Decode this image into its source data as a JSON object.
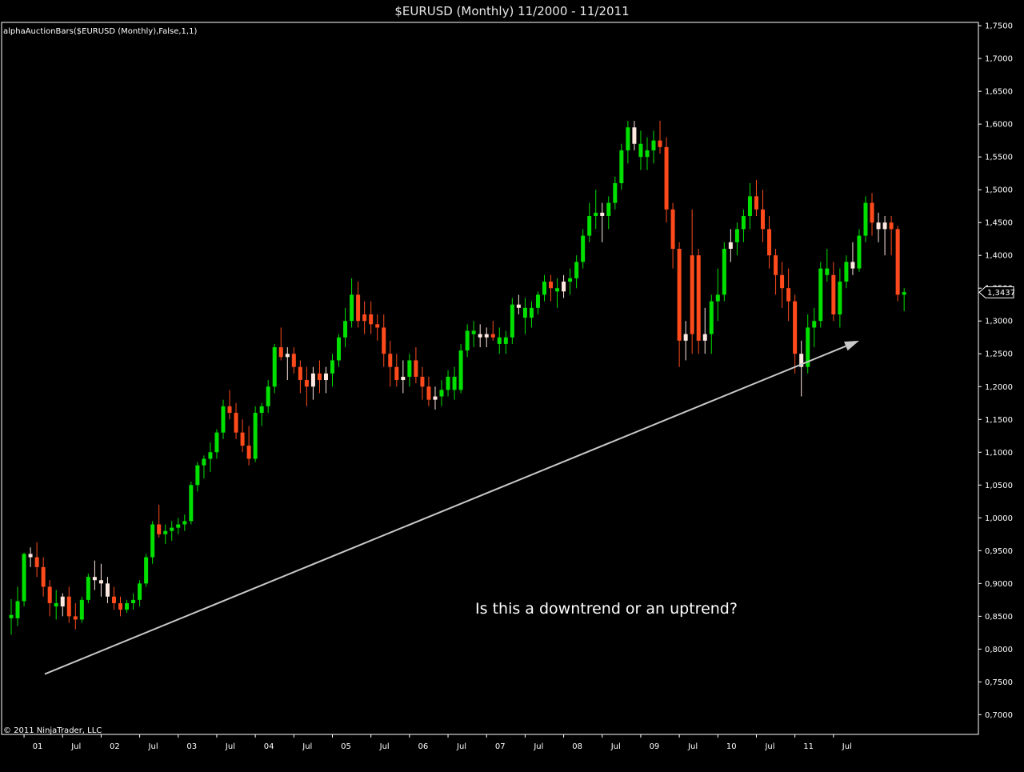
{
  "window": {
    "title": "$EURUSD (Monthly)  11/2000 - 11/2011"
  },
  "indicator_label": "alphaAuctionBars($EURUSD (Monthly),False,1,1)",
  "copyright": "© 2011 NinjaTrader, LLC",
  "annotation": {
    "text": "Is this a downtrend or an uptrend?"
  },
  "colors": {
    "background": "#000000",
    "up": "#00e000",
    "down": "#ff4a1c",
    "neutral": "#ffe8e0",
    "trend_arrow": "#c8c8c8",
    "axis": "#ffffff"
  },
  "chart_data": {
    "type": "candlestick",
    "symbol": "$EURUSD",
    "timeframe": "Monthly",
    "ylim": [
      0.67,
      1.755
    ],
    "y_ticks": [
      "1,7500",
      "1,7000",
      "1,6500",
      "1,6000",
      "1,5500",
      "1,5000",
      "1,4500",
      "1,4000",
      "1,3500",
      "1,3000",
      "1,2500",
      "1,2000",
      "1,1500",
      "1,1000",
      "1,0500",
      "1,0000",
      "0,9500",
      "0,9000",
      "0,8500",
      "0,8000",
      "0,7500",
      "0,7000"
    ],
    "x_ticks": [
      "01",
      "Jul",
      "02",
      "Jul",
      "03",
      "Jul",
      "04",
      "Jul",
      "05",
      "Jul",
      "06",
      "Jul",
      "07",
      "Jul",
      "08",
      "Jul",
      "09",
      "Jul",
      "10",
      "Jul",
      "11",
      "Jul"
    ],
    "last_price": "1,3437",
    "trend_arrow": {
      "from": [
        0,
        0.762
      ],
      "to": [
        132,
        1.27
      ]
    },
    "candles": [
      [
        0.852,
        0.876,
        0.822,
        0.847,
        "up"
      ],
      [
        0.847,
        0.895,
        0.835,
        0.873,
        "up"
      ],
      [
        0.873,
        0.947,
        0.865,
        0.945,
        "up"
      ],
      [
        0.945,
        0.955,
        0.925,
        0.94,
        "neutral"
      ],
      [
        0.94,
        0.963,
        0.91,
        0.925,
        "down"
      ],
      [
        0.925,
        0.94,
        0.88,
        0.895,
        "down"
      ],
      [
        0.895,
        0.905,
        0.85,
        0.87,
        "down"
      ],
      [
        0.87,
        0.89,
        0.845,
        0.865,
        "up"
      ],
      [
        0.865,
        0.885,
        0.85,
        0.88,
        "neutral"
      ],
      [
        0.88,
        0.895,
        0.84,
        0.85,
        "down"
      ],
      [
        0.85,
        0.87,
        0.83,
        0.845,
        "down"
      ],
      [
        0.845,
        0.88,
        0.84,
        0.875,
        "up"
      ],
      [
        0.875,
        0.915,
        0.87,
        0.91,
        "up"
      ],
      [
        0.91,
        0.935,
        0.89,
        0.905,
        "neutral"
      ],
      [
        0.905,
        0.93,
        0.88,
        0.9,
        "neutral"
      ],
      [
        0.9,
        0.91,
        0.87,
        0.88,
        "neutral"
      ],
      [
        0.88,
        0.895,
        0.86,
        0.87,
        "down"
      ],
      [
        0.87,
        0.88,
        0.85,
        0.86,
        "down"
      ],
      [
        0.86,
        0.875,
        0.855,
        0.87,
        "up"
      ],
      [
        0.87,
        0.885,
        0.86,
        0.875,
        "up"
      ],
      [
        0.875,
        0.905,
        0.865,
        0.9,
        "up"
      ],
      [
        0.9,
        0.945,
        0.895,
        0.94,
        "up"
      ],
      [
        0.94,
        0.995,
        0.93,
        0.99,
        "up"
      ],
      [
        0.99,
        1.02,
        0.97,
        0.975,
        "down"
      ],
      [
        0.975,
        0.99,
        0.96,
        0.98,
        "up"
      ],
      [
        0.98,
        0.995,
        0.965,
        0.985,
        "up"
      ],
      [
        0.985,
        1.0,
        0.975,
        0.99,
        "up"
      ],
      [
        0.99,
        1.005,
        0.98,
        0.995,
        "up"
      ],
      [
        0.995,
        1.055,
        0.99,
        1.05,
        "up"
      ],
      [
        1.05,
        1.085,
        1.04,
        1.08,
        "up"
      ],
      [
        1.08,
        1.095,
        1.06,
        1.09,
        "up"
      ],
      [
        1.09,
        1.115,
        1.07,
        1.1,
        "up"
      ],
      [
        1.1,
        1.135,
        1.09,
        1.13,
        "up"
      ],
      [
        1.13,
        1.18,
        1.12,
        1.17,
        "up"
      ],
      [
        1.17,
        1.195,
        1.15,
        1.16,
        "down"
      ],
      [
        1.16,
        1.175,
        1.12,
        1.13,
        "down"
      ],
      [
        1.13,
        1.15,
        1.1,
        1.11,
        "down"
      ],
      [
        1.11,
        1.14,
        1.08,
        1.09,
        "down"
      ],
      [
        1.09,
        1.17,
        1.085,
        1.16,
        "up"
      ],
      [
        1.16,
        1.175,
        1.14,
        1.17,
        "up"
      ],
      [
        1.17,
        1.21,
        1.16,
        1.2,
        "up"
      ],
      [
        1.2,
        1.265,
        1.19,
        1.26,
        "up"
      ],
      [
        1.26,
        1.29,
        1.24,
        1.245,
        "down"
      ],
      [
        1.245,
        1.26,
        1.21,
        1.25,
        "neutral"
      ],
      [
        1.25,
        1.26,
        1.22,
        1.23,
        "down"
      ],
      [
        1.23,
        1.24,
        1.19,
        1.21,
        "down"
      ],
      [
        1.21,
        1.23,
        1.17,
        1.2,
        "down"
      ],
      [
        1.2,
        1.23,
        1.18,
        1.22,
        "neutral"
      ],
      [
        1.22,
        1.24,
        1.19,
        1.21,
        "down"
      ],
      [
        1.21,
        1.23,
        1.19,
        1.22,
        "neutral"
      ],
      [
        1.22,
        1.25,
        1.2,
        1.24,
        "up"
      ],
      [
        1.24,
        1.28,
        1.23,
        1.275,
        "up"
      ],
      [
        1.275,
        1.32,
        1.26,
        1.3,
        "up"
      ],
      [
        1.3,
        1.365,
        1.29,
        1.34,
        "up"
      ],
      [
        1.34,
        1.36,
        1.29,
        1.3,
        "down"
      ],
      [
        1.3,
        1.33,
        1.28,
        1.31,
        "down"
      ],
      [
        1.31,
        1.33,
        1.28,
        1.295,
        "down"
      ],
      [
        1.295,
        1.31,
        1.27,
        1.29,
        "down"
      ],
      [
        1.29,
        1.31,
        1.23,
        1.25,
        "down"
      ],
      [
        1.25,
        1.27,
        1.2,
        1.23,
        "down"
      ],
      [
        1.23,
        1.25,
        1.2,
        1.21,
        "down"
      ],
      [
        1.21,
        1.24,
        1.19,
        1.215,
        "neutral"
      ],
      [
        1.215,
        1.25,
        1.2,
        1.24,
        "up"
      ],
      [
        1.24,
        1.26,
        1.205,
        1.215,
        "down"
      ],
      [
        1.215,
        1.23,
        1.18,
        1.2,
        "down"
      ],
      [
        1.2,
        1.215,
        1.17,
        1.18,
        "down"
      ],
      [
        1.18,
        1.2,
        1.165,
        1.185,
        "neutral"
      ],
      [
        1.185,
        1.21,
        1.17,
        1.195,
        "up"
      ],
      [
        1.195,
        1.225,
        1.185,
        1.215,
        "up"
      ],
      [
        1.215,
        1.23,
        1.18,
        1.195,
        "up"
      ],
      [
        1.195,
        1.265,
        1.19,
        1.255,
        "up"
      ],
      [
        1.255,
        1.295,
        1.245,
        1.285,
        "up"
      ],
      [
        1.285,
        1.3,
        1.26,
        1.28,
        "up"
      ],
      [
        1.28,
        1.295,
        1.26,
        1.275,
        "neutral"
      ],
      [
        1.275,
        1.29,
        1.26,
        1.28,
        "neutral"
      ],
      [
        1.28,
        1.3,
        1.27,
        1.275,
        "down"
      ],
      [
        1.275,
        1.29,
        1.25,
        1.265,
        "up"
      ],
      [
        1.265,
        1.285,
        1.25,
        1.275,
        "up"
      ],
      [
        1.275,
        1.335,
        1.265,
        1.325,
        "up"
      ],
      [
        1.325,
        1.34,
        1.31,
        1.32,
        "neutral"
      ],
      [
        1.32,
        1.335,
        1.28,
        1.305,
        "up"
      ],
      [
        1.305,
        1.33,
        1.29,
        1.32,
        "up"
      ],
      [
        1.32,
        1.345,
        1.31,
        1.34,
        "up"
      ],
      [
        1.34,
        1.37,
        1.33,
        1.36,
        "up"
      ],
      [
        1.36,
        1.37,
        1.33,
        1.35,
        "down"
      ],
      [
        1.35,
        1.365,
        1.32,
        1.345,
        "up"
      ],
      [
        1.345,
        1.37,
        1.335,
        1.36,
        "neutral"
      ],
      [
        1.36,
        1.38,
        1.34,
        1.365,
        "up"
      ],
      [
        1.365,
        1.4,
        1.35,
        1.39,
        "up"
      ],
      [
        1.39,
        1.44,
        1.38,
        1.43,
        "up"
      ],
      [
        1.43,
        1.48,
        1.42,
        1.46,
        "up"
      ],
      [
        1.46,
        1.5,
        1.44,
        1.465,
        "up"
      ],
      [
        1.465,
        1.48,
        1.42,
        1.46,
        "neutral"
      ],
      [
        1.46,
        1.49,
        1.44,
        1.48,
        "up"
      ],
      [
        1.48,
        1.52,
        1.47,
        1.51,
        "up"
      ],
      [
        1.51,
        1.57,
        1.5,
        1.56,
        "up"
      ],
      [
        1.56,
        1.605,
        1.54,
        1.595,
        "up"
      ],
      [
        1.595,
        1.605,
        1.56,
        1.57,
        "neutral"
      ],
      [
        1.57,
        1.59,
        1.53,
        1.55,
        "up"
      ],
      [
        1.55,
        1.58,
        1.53,
        1.56,
        "up"
      ],
      [
        1.56,
        1.59,
        1.54,
        1.575,
        "up"
      ],
      [
        1.575,
        1.605,
        1.555,
        1.565,
        "down"
      ],
      [
        1.565,
        1.58,
        1.45,
        1.47,
        "down"
      ],
      [
        1.47,
        1.48,
        1.38,
        1.41,
        "down"
      ],
      [
        1.41,
        1.42,
        1.23,
        1.27,
        "down"
      ],
      [
        1.27,
        1.3,
        1.24,
        1.28,
        "neutral"
      ],
      [
        1.28,
        1.47,
        1.25,
        1.4,
        "down"
      ],
      [
        1.4,
        1.41,
        1.25,
        1.27,
        "down"
      ],
      [
        1.27,
        1.32,
        1.25,
        1.28,
        "neutral"
      ],
      [
        1.28,
        1.34,
        1.25,
        1.33,
        "up"
      ],
      [
        1.33,
        1.38,
        1.3,
        1.34,
        "up"
      ],
      [
        1.34,
        1.42,
        1.33,
        1.41,
        "up"
      ],
      [
        1.41,
        1.44,
        1.39,
        1.42,
        "neutral"
      ],
      [
        1.42,
        1.45,
        1.4,
        1.44,
        "up"
      ],
      [
        1.44,
        1.47,
        1.42,
        1.46,
        "up"
      ],
      [
        1.46,
        1.51,
        1.44,
        1.49,
        "up"
      ],
      [
        1.49,
        1.515,
        1.46,
        1.47,
        "down"
      ],
      [
        1.47,
        1.5,
        1.42,
        1.44,
        "down"
      ],
      [
        1.44,
        1.46,
        1.38,
        1.4,
        "down"
      ],
      [
        1.4,
        1.41,
        1.34,
        1.37,
        "down"
      ],
      [
        1.37,
        1.39,
        1.32,
        1.35,
        "down"
      ],
      [
        1.35,
        1.38,
        1.3,
        1.33,
        "down"
      ],
      [
        1.33,
        1.34,
        1.22,
        1.25,
        "down"
      ],
      [
        1.25,
        1.27,
        1.185,
        1.23,
        "neutral"
      ],
      [
        1.23,
        1.31,
        1.22,
        1.29,
        "up"
      ],
      [
        1.29,
        1.32,
        1.26,
        1.3,
        "up"
      ],
      [
        1.3,
        1.39,
        1.29,
        1.38,
        "up"
      ],
      [
        1.38,
        1.41,
        1.36,
        1.37,
        "up"
      ],
      [
        1.37,
        1.39,
        1.3,
        1.31,
        "down"
      ],
      [
        1.31,
        1.38,
        1.29,
        1.36,
        "up"
      ],
      [
        1.36,
        1.4,
        1.35,
        1.39,
        "up"
      ],
      [
        1.39,
        1.42,
        1.37,
        1.38,
        "neutral"
      ],
      [
        1.38,
        1.44,
        1.375,
        1.43,
        "up"
      ],
      [
        1.43,
        1.49,
        1.42,
        1.48,
        "up"
      ],
      [
        1.48,
        1.495,
        1.43,
        1.45,
        "down"
      ],
      [
        1.45,
        1.465,
        1.42,
        1.44,
        "neutral"
      ],
      [
        1.44,
        1.46,
        1.4,
        1.45,
        "neutral"
      ],
      [
        1.45,
        1.46,
        1.4,
        1.44,
        "down"
      ],
      [
        1.44,
        1.445,
        1.33,
        1.34,
        "down"
      ],
      [
        1.34,
        1.35,
        1.315,
        1.344,
        "up"
      ]
    ]
  }
}
